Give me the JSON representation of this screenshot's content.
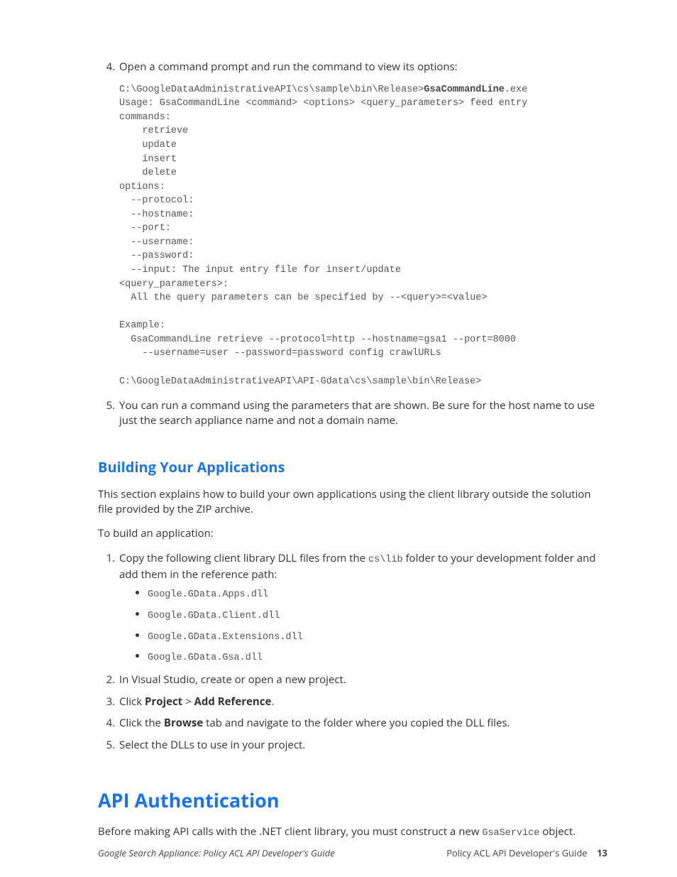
{
  "step4": {
    "num": "4.",
    "text": "Open a command prompt and run the command to view its options:"
  },
  "code": {
    "l1a": "C:\\GoogleDataAdministrativeAPI\\cs\\sample\\bin\\Release>",
    "l1b": "GsaCommandLine",
    "l1c": ".exe",
    "l2": "Usage: GsaCommandLine <command> <options> <query_parameters> feed entry",
    "l3": "commands:",
    "l4": "    retrieve",
    "l5": "    update",
    "l6": "    insert",
    "l7": "    delete",
    "l8": "options:",
    "l9": "  --protocol:",
    "l10": "  --hostname:",
    "l11": "  --port:",
    "l12": "  --username:",
    "l13": "  --password:",
    "l14": "  --input: The input entry file for insert/update",
    "l15": "<query_parameters>:",
    "l16": "  All the query parameters can be specified by --<query>=<value>",
    "l17": "",
    "l18": "Example:",
    "l19": "  GsaCommandLine retrieve --protocol=http --hostname=gsa1 --port=8000",
    "l20": "    --username=user --password=password config crawlURLs",
    "l21": "",
    "l22": "C:\\GoogleDataAdministrativeAPI\\API-Gdata\\cs\\sample\\bin\\Release>"
  },
  "step5": {
    "text": "You can run a command using the parameters that are shown. Be sure for the host name to use just the search appliance name and not a domain name."
  },
  "section1": {
    "title": "Building Your Applications",
    "p1": "This section explains how to build your own applications using the client library outside the solution file provided by the ZIP archive.",
    "p2": "To build an application:"
  },
  "build": {
    "s1a": "Copy the following client library DLL files from the ",
    "s1code": "cs\\lib",
    "s1b": " folder to your development folder and add them in the reference path:",
    "dlls": [
      "Google.GData.Apps.dll",
      "Google.GData.Client.dll",
      "Google.GData.Extensions.dll",
      "Google.GData.Gsa.dll"
    ],
    "s2": "In Visual Studio, create or open a new project.",
    "s3a": "Click ",
    "s3b": "Project",
    "s3c": " > ",
    "s3d": "Add Reference",
    "s3e": ".",
    "s4a": "Click the ",
    "s4b": "Browse",
    "s4c": " tab and navigate to the folder where you copied the DLL files.",
    "s5": "Select the DLLs to use in your project."
  },
  "section2": {
    "title": "API Authentication",
    "p1a": "Before making API calls with the .NET client library, you must construct a new ",
    "p1code": "GsaService",
    "p1b": " object."
  },
  "footer": {
    "left": "Google Search Appliance: Policy ACL API Developer's Guide",
    "right_label": "Policy ACL API Developer's Guide",
    "page": "13"
  }
}
